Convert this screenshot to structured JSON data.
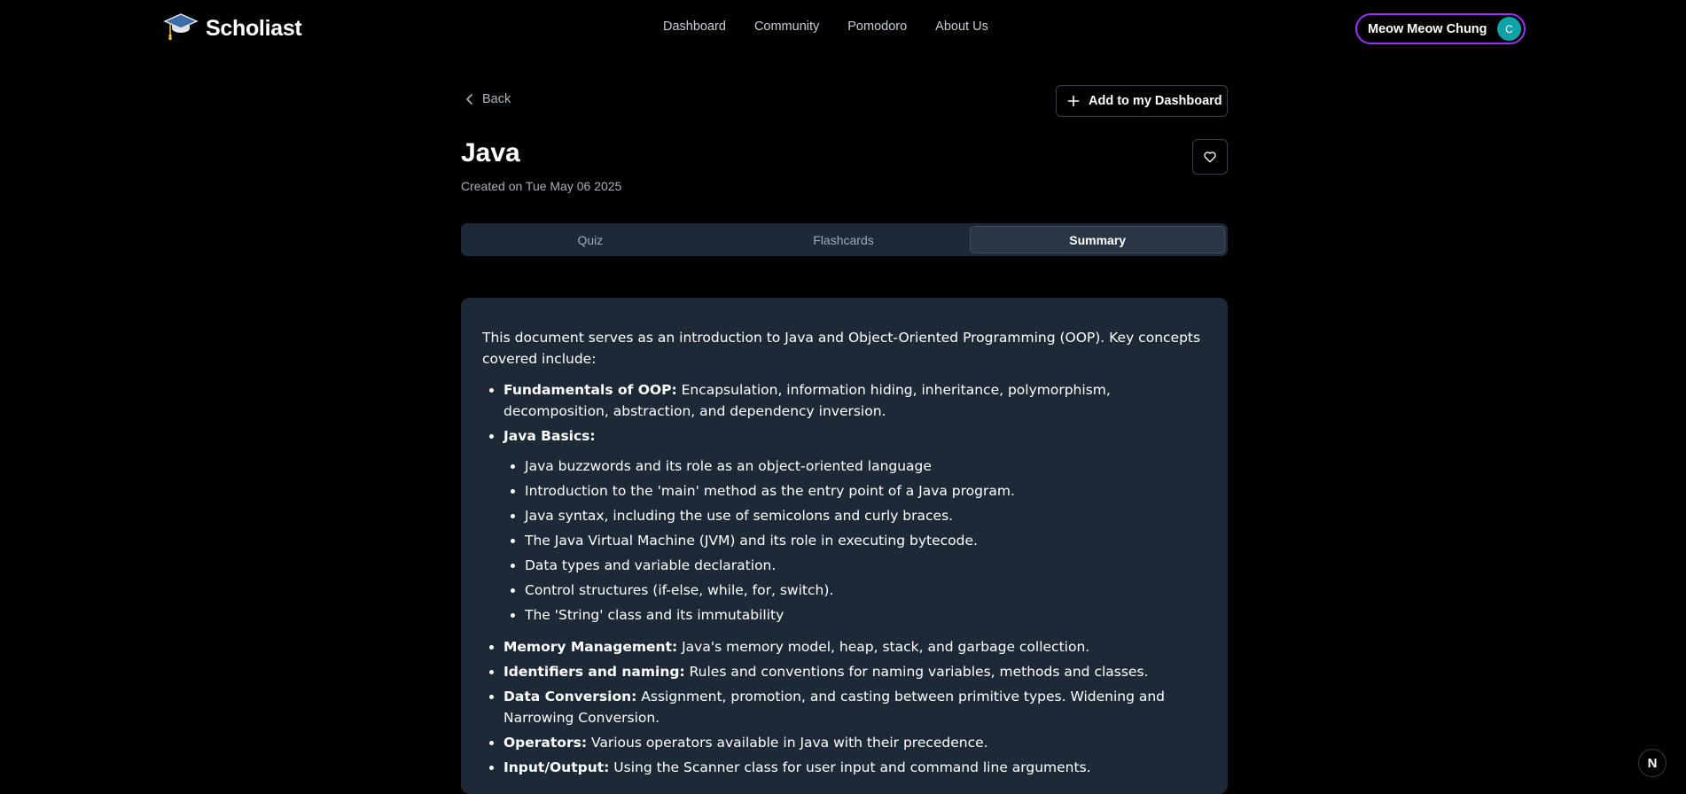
{
  "brand": {
    "name": "Scholiast",
    "logo_icon": "graduation-cap-icon"
  },
  "nav": {
    "items": [
      "Dashboard",
      "Community",
      "Pomodoro",
      "About Us"
    ]
  },
  "user": {
    "name": "Meow Meow Chung",
    "avatar_initial": "C",
    "border_color": "#9b30ff",
    "avatar_color": "#0fa3a8"
  },
  "header": {
    "back_label": "Back",
    "add_button_label": "Add to my Dashboard",
    "title": "Java",
    "created": "Created on Tue May 06 2025"
  },
  "tabs": [
    {
      "label": "Quiz",
      "active": false
    },
    {
      "label": "Flashcards",
      "active": false
    },
    {
      "label": "Summary",
      "active": true
    }
  ],
  "summary": {
    "intro": "This document serves as an introduction to Java and Object-Oriented Programming (OOP). Key concepts covered include:",
    "items": [
      {
        "term": "Fundamentals of OOP:",
        "text": " Encapsulation, information hiding, inheritance, polymorphism, decomposition, abstraction, and dependency inversion."
      },
      {
        "term": "Java Basics:",
        "text": "",
        "subitems": [
          "Java buzzwords and its role as an object-oriented language",
          "Introduction to the 'main' method as the entry point of a Java program.",
          "Java syntax, including the use of semicolons and curly braces.",
          "The Java Virtual Machine (JVM) and its role in executing bytecode.",
          "Data types and variable declaration.",
          "Control structures (if-else, while, for, switch).",
          "The 'String' class and its immutability"
        ]
      },
      {
        "term": "Memory Management:",
        "text": " Java's memory model, heap, stack, and garbage collection."
      },
      {
        "term": "Identifiers and naming:",
        "text": " Rules and conventions for naming variables, methods and classes."
      },
      {
        "term": "Data Conversion:",
        "text": " Assignment, promotion, and casting between primitive types. Widening and Narrowing Conversion."
      },
      {
        "term": "Operators:",
        "text": " Various operators available in Java with their precedence."
      },
      {
        "term": "Input/Output:",
        "text": " Using the Scanner class for user input and command line arguments."
      }
    ]
  },
  "corner_badge": {
    "label": "N"
  }
}
